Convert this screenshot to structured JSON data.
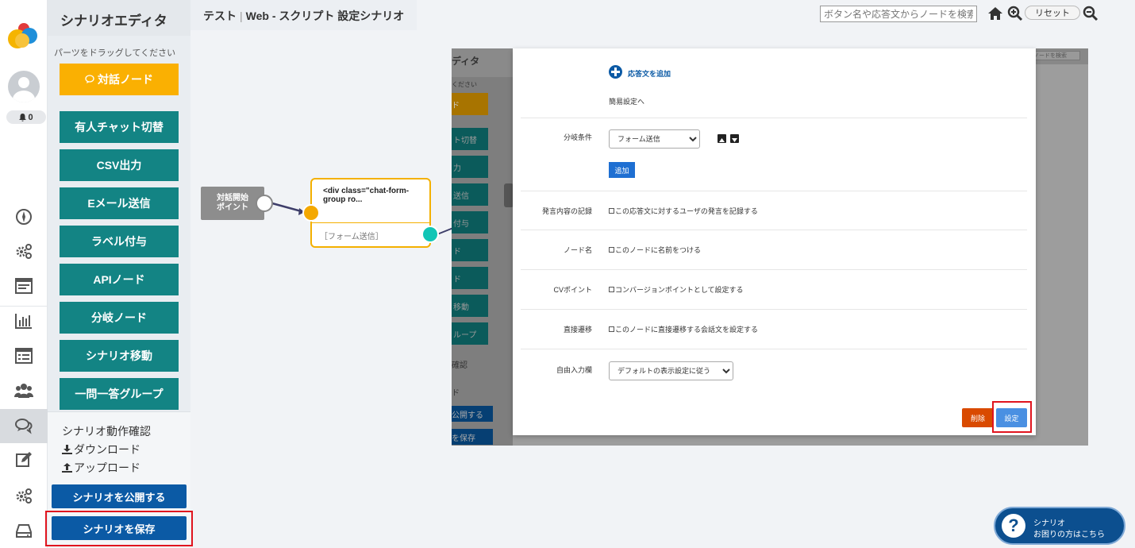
{
  "app": {
    "panel_title": "シナリオエディタ",
    "breadcrumb": {
      "project": "テスト",
      "separator": "|",
      "scenario": "Web - スクリプト 設定シナリオ"
    },
    "notifications_count": "0"
  },
  "header": {
    "search_placeholder": "ボタン名や応答文からノードを検索",
    "reset_label": "リセット"
  },
  "parts_panel": {
    "hint": "パーツをドラッグしてください",
    "dialog_node": "対話ノード",
    "items": [
      "有人チャット切替",
      "CSV出力",
      "Eメール送信",
      "ラベル付与",
      "APIノード",
      "分岐ノード",
      "シナリオ移動",
      "一問一答グループ"
    ],
    "check_label": "シナリオ動作確認",
    "download_label": "ダウンロード",
    "upload_label": "アップロード",
    "publish_button": "シナリオを公開する",
    "save_button": "シナリオを保存"
  },
  "canvas": {
    "start_node": {
      "line1": "対話開始",
      "line2": "ポイント"
    },
    "message_node": {
      "content": "<div class=\"chat-form-group ro...",
      "subtext": "［フォーム送信］"
    }
  },
  "background_screenshot": {
    "title_fragment": "ディタ",
    "hint_fragment": "ください",
    "button_fragments": [
      "ド",
      "ト切替",
      "力",
      "送信",
      "付与",
      "ド",
      "ド",
      "移動",
      "ループ"
    ],
    "link_fragments": [
      "確認",
      "ド"
    ],
    "publish_fragment": "公開する",
    "save_fragment": "を保存",
    "search_fragment": "ノードを検索"
  },
  "modal": {
    "add_response": "応答文を追加",
    "simple_settings": "簡易設定へ",
    "branch_label": "分岐条件",
    "branch_value": "フォーム送信",
    "add_button": "追加",
    "record_label": "発言内容の記録",
    "record_text": "この応答文に対するユーザの発言を記録する",
    "node_name_label": "ノード名",
    "node_name_text": "このノードに名前をつける",
    "cv_label": "CVポイント",
    "cv_text": "コンバージョンポイントとして設定する",
    "direct_label": "直接遷移",
    "direct_text": "このノードに直接遷移する会話文を設定する",
    "free_input_label": "自由入力欄",
    "free_input_value": "デフォルトの表示設定に従う",
    "delete_button": "削除",
    "set_button": "設定"
  },
  "help": {
    "line1": "シナリオ",
    "line2": "お困りの方はこちら",
    "icon": "?"
  },
  "colors": {
    "teal": "#138484",
    "dialog_yellow": "#fab002",
    "primary_blue": "#0b5aa5",
    "highlight_red": "#e0141e",
    "node_orange": "#f4a800",
    "port_cyan": "#11c5b6"
  }
}
